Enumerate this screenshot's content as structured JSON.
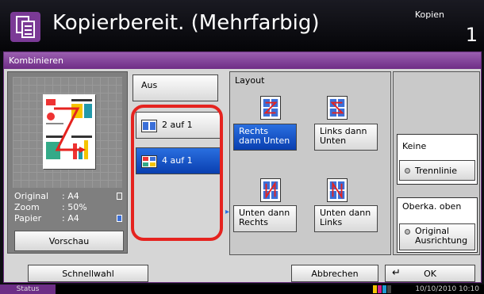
{
  "header": {
    "title": "Kopierbereit. (Mehrfarbig)",
    "mode": "Kopien",
    "count": "1"
  },
  "window": {
    "title": "Kombinieren"
  },
  "preview": {
    "rows": [
      {
        "key": "Original",
        "value": ": A4"
      },
      {
        "key": "Zoom",
        "value": ": 50%"
      },
      {
        "key": "Papier",
        "value": ": A4"
      }
    ],
    "button": "Vorschau"
  },
  "options": {
    "off": "Aus",
    "two_in_one": "2 auf 1",
    "four_in_one": "4 auf 1",
    "selected": "4 auf 1"
  },
  "layout": {
    "title": "Layout",
    "items": [
      {
        "label": "Rechts dann Unten",
        "selected": true
      },
      {
        "label": "Links dann Unten",
        "selected": false
      },
      {
        "label": "Unten dann Rechts",
        "selected": false
      },
      {
        "label": "Unten dann Links",
        "selected": false
      }
    ]
  },
  "side": {
    "border_value": "Keine",
    "border_button": "Trennlinie",
    "orientation_value": "Oberka. oben",
    "orientation_button": "Original Ausrichtung"
  },
  "bottom": {
    "quick": "Schnellwahl",
    "cancel": "Abbrechen",
    "ok": "OK"
  },
  "status": {
    "label": "Status",
    "datetime": "10/10/2010  10:10"
  },
  "colors": {
    "accent": "#6f2d86",
    "selected": "#0a3fb0",
    "highlight": "#e5231f"
  }
}
